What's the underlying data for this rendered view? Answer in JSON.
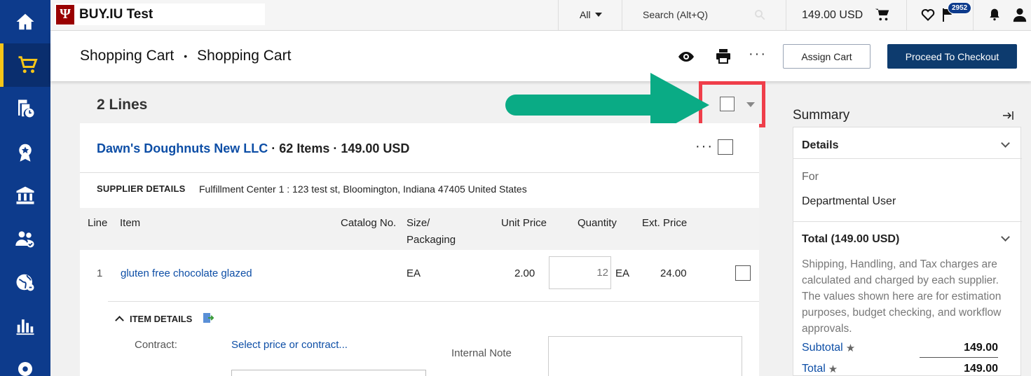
{
  "app": {
    "logo_letter": "Ψ",
    "title": "BUY.IU Test"
  },
  "topbar": {
    "scope": "All",
    "search_placeholder": "Search (Alt+Q)",
    "cart_total": "149.00 USD",
    "notifications_count": "2952"
  },
  "sidebar": {
    "items": [
      {
        "icon": "home-icon"
      },
      {
        "icon": "cart-icon",
        "active": true
      },
      {
        "icon": "documents-clock-icon"
      },
      {
        "icon": "award-icon"
      },
      {
        "icon": "bank-icon"
      },
      {
        "icon": "users-icon"
      },
      {
        "icon": "globe-icon"
      },
      {
        "icon": "bar-chart-icon"
      },
      {
        "icon": "gear-icon"
      }
    ]
  },
  "header": {
    "breadcrumb": [
      "Shopping Cart",
      "Shopping Cart"
    ],
    "separator": "•",
    "more_label": "···",
    "assign_label": "Assign Cart",
    "checkout_label": "Proceed To Checkout"
  },
  "main": {
    "lines_count": "2 Lines"
  },
  "supplier": {
    "name": "Dawn's Doughnuts New LLC",
    "items": "· 62 Items",
    "total": "· 149.00 USD",
    "details_label": "SUPPLIER DETAILS",
    "details_value": "Fulfillment Center 1 : 123 test st, Bloomington, Indiana 47405 United States",
    "more_label": "···"
  },
  "table": {
    "headers": {
      "line": "Line",
      "item": "Item",
      "catalog": "Catalog No.",
      "size": "Size/",
      "packaging": "Packaging",
      "unit_price": "Unit Price",
      "quantity": "Quantity",
      "ext_price": "Ext. Price"
    },
    "rows": [
      {
        "line": "1",
        "item": "gluten free chocolate glazed",
        "size": "EA",
        "unit_price": "2.00",
        "quantity": "12",
        "uom": "EA",
        "ext_price": "24.00"
      }
    ]
  },
  "item_details": {
    "label": "ITEM DETAILS",
    "contract_label": "Contract:",
    "contract_link": "Select price or contract...",
    "internal_note_label": "Internal Note"
  },
  "summary": {
    "title": "Summary",
    "details_header": "Details",
    "for_label": "For",
    "for_value": "Departmental User",
    "total_header": "Total (149.00 USD)",
    "note": "Shipping, Handling, and Tax charges are calculated and charged by each supplier. The values shown here are for estimation purposes, budget checking, and workflow approvals.",
    "subtotal_label": "Subtotal",
    "subtotal_value": "149.00",
    "total_label": "Total",
    "total_value": "149.00"
  },
  "annotation": {
    "arrow_color": "#0aab85",
    "highlight_color": "#ef3e4a"
  }
}
